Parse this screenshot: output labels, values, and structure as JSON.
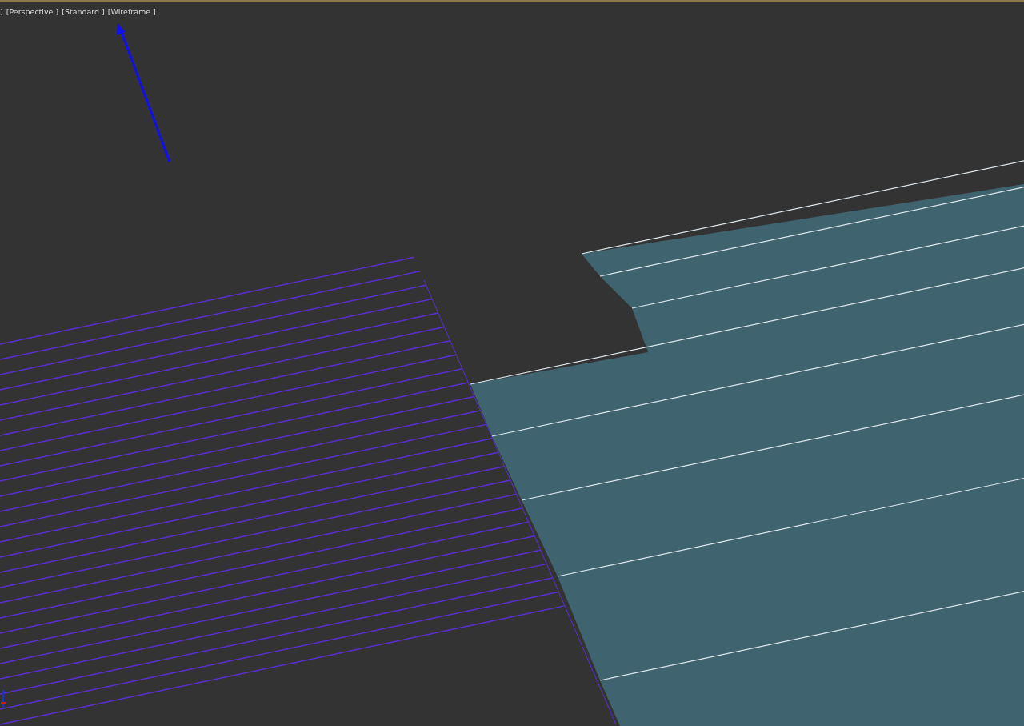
{
  "viewport": {
    "labels": [
      {
        "text": "]"
      },
      {
        "text": "[Perspective ]"
      },
      {
        "text": "[Standard ]"
      },
      {
        "text": "[Wireframe ]"
      }
    ]
  }
}
